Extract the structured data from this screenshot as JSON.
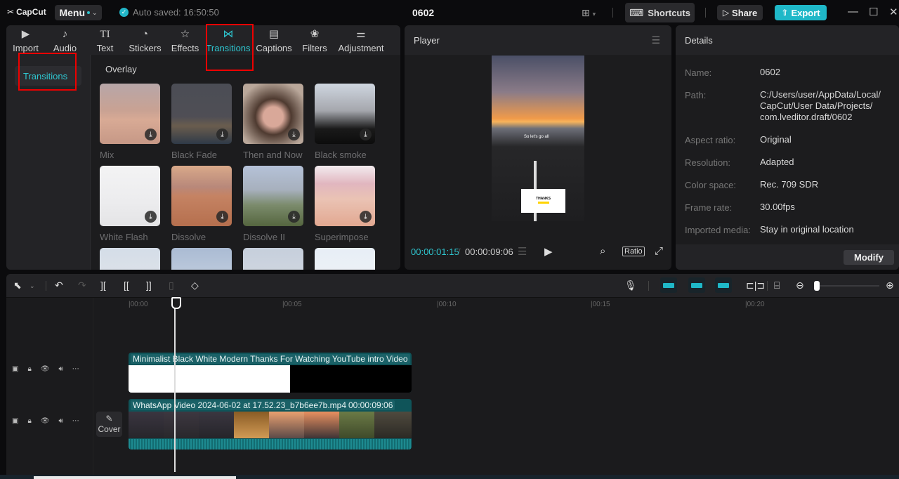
{
  "titlebar": {
    "app_name": "CapCut",
    "menu_label": "Menu",
    "autosave": "Auto saved: 16:50:50",
    "project_title": "0602",
    "shortcuts_label": "Shortcuts",
    "share_label": "Share",
    "export_label": "Export",
    "minimize": "—",
    "maximize": "☐",
    "close": "✕"
  },
  "media_tabs": [
    {
      "label": "Import",
      "icon": "▶"
    },
    {
      "label": "Audio",
      "icon": "♪"
    },
    {
      "label": "Text",
      "icon": "TI"
    },
    {
      "label": "Stickers",
      "icon": "◔"
    },
    {
      "label": "Effects",
      "icon": "☆"
    },
    {
      "label": "Transitions",
      "icon": "⋈",
      "active": true
    },
    {
      "label": "Captions",
      "icon": "▤"
    },
    {
      "label": "Filters",
      "icon": "❀"
    },
    {
      "label": "Adjustment",
      "icon": "⚌"
    }
  ],
  "sidebar": {
    "selected": "Transitions"
  },
  "section_title": "Overlay",
  "transitions": [
    {
      "label": "Mix"
    },
    {
      "label": "Black Fade"
    },
    {
      "label": "Then and Now"
    },
    {
      "label": "Black smoke"
    },
    {
      "label": "White Flash"
    },
    {
      "label": "Dissolve"
    },
    {
      "label": "Dissolve II"
    },
    {
      "label": "Superimpose"
    }
  ],
  "player": {
    "title": "Player",
    "current_time": "00:00:01:15",
    "separator": "/",
    "total_time": "00:00:09:06",
    "ratio_label": "Ratio",
    "caption_text": "So let's go all",
    "card_text": "THANKS"
  },
  "details": {
    "title": "Details",
    "rows": [
      {
        "label": "Name:",
        "value": "0602"
      },
      {
        "label": "Path:",
        "value": "C:/Users/user/AppData/Local/ CapCut/User Data/Projects/ com.lveditor.draft/0602"
      },
      {
        "label": "Aspect ratio:",
        "value": "Original"
      },
      {
        "label": "Resolution:",
        "value": "Adapted"
      },
      {
        "label": "Color space:",
        "value": "Rec. 709 SDR"
      },
      {
        "label": "Frame rate:",
        "value": "30.00fps"
      },
      {
        "label": "Imported media:",
        "value": "Stay in original location"
      }
    ],
    "modify_label": "Modify"
  },
  "timeline": {
    "ruler": [
      "|00:00",
      "|00:05",
      "|00:10",
      "|00:15",
      "|00:20"
    ],
    "zoom_level": 0.05,
    "cover_label": "Cover",
    "tracks": [
      {
        "clip_name": "Minimalist Black White Modern Thanks For Watching YouTube intro Video"
      },
      {
        "clip_name": "WhatsApp Video 2024-06-02 at 17.52.23_b7b6ee7b.mp4",
        "duration": "00:00:09:06"
      }
    ]
  }
}
